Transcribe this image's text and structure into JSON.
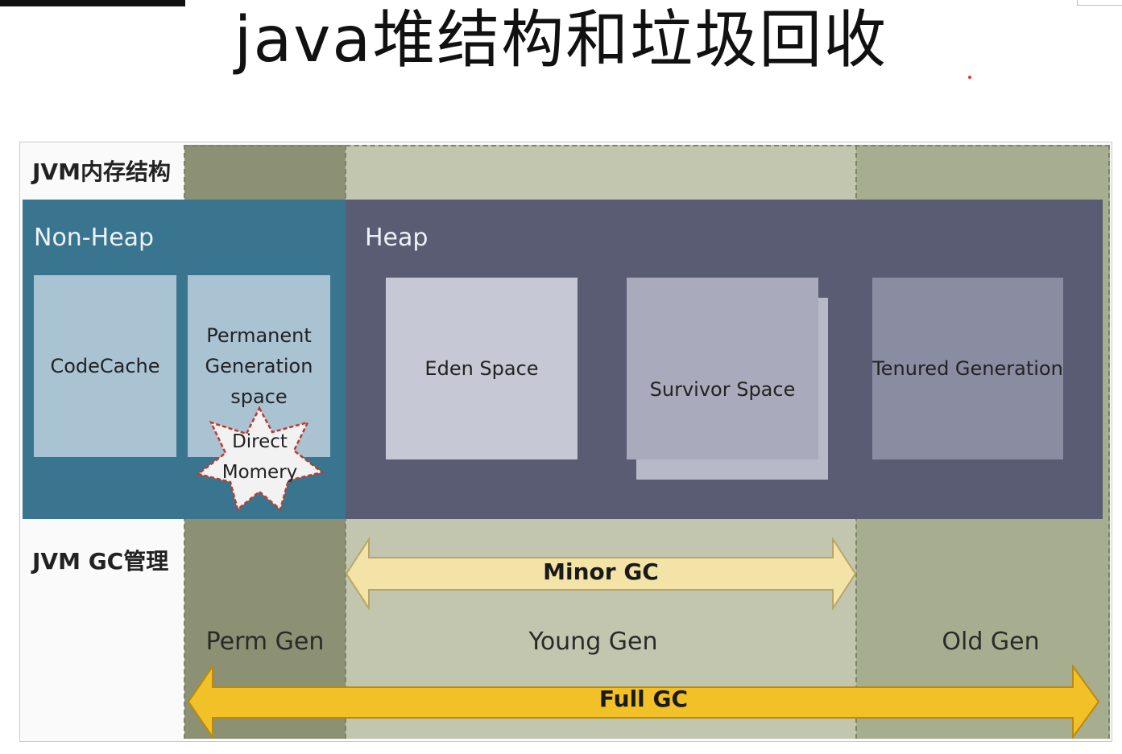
{
  "title": "java堆结构和垃圾回收",
  "rows": {
    "structure_label": "JVM内存结构",
    "gc_label": "JVM GC管理"
  },
  "nonheap": {
    "title": "Non-Heap",
    "codecache": "CodeCache",
    "perm_lines": [
      "Permanent",
      "Generation",
      "space"
    ],
    "direct_lines": [
      "Direct",
      "Momery"
    ]
  },
  "heap": {
    "title": "Heap",
    "eden": "Eden Space",
    "survivor": "Survivor Space",
    "tenured": "Tenured Generation"
  },
  "generations": {
    "perm": "Perm Gen",
    "young": "Young Gen",
    "old": "Old Gen"
  },
  "gc": {
    "minor": "Minor GC",
    "full": "Full GC"
  },
  "colors": {
    "nonheap": "#3a7590",
    "heap": "#5a5c74",
    "minor_arrow": "#f3e3a6",
    "full_arrow": "#f2c127",
    "star_border": "#c0392b"
  }
}
